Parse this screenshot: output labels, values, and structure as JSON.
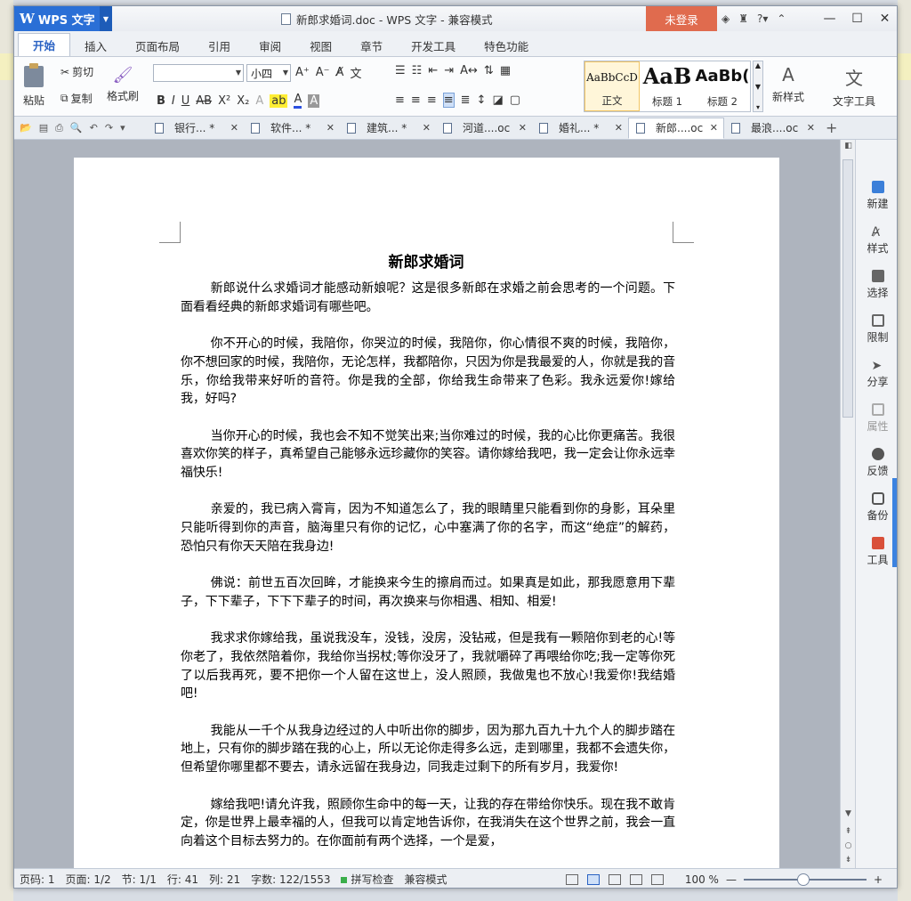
{
  "app": {
    "name": "WPS 文字",
    "login": "未登录"
  },
  "window": {
    "title": "新郎求婚词.doc - WPS 文字 - 兼容模式"
  },
  "menu": [
    "开始",
    "插入",
    "页面布局",
    "引用",
    "审阅",
    "视图",
    "章节",
    "开发工具",
    "特色功能"
  ],
  "ribbon": {
    "paste": "粘贴",
    "cut": "剪切",
    "copy": "复制",
    "format_painter": "格式刷",
    "font_size": "小四",
    "styles": [
      {
        "sample": "AaBbCcD",
        "name": "正文"
      },
      {
        "sample": "AaB",
        "name": "标题 1"
      },
      {
        "sample": "AaBb(",
        "name": "标题 2"
      }
    ],
    "new_style": "新样式",
    "text_tools": "文字工具"
  },
  "tabs": [
    {
      "label": "银行... *",
      "active": false
    },
    {
      "label": "软件... *",
      "active": false
    },
    {
      "label": "建筑... *",
      "active": false
    },
    {
      "label": "河道....oc",
      "active": false
    },
    {
      "label": "婚礼... *",
      "active": false
    },
    {
      "label": "新郎....oc",
      "active": true
    },
    {
      "label": "最浪....oc",
      "active": false
    }
  ],
  "document": {
    "title": "新郎求婚词",
    "paragraphs": [
      "新郎说什么求婚词才能感动新娘呢？这是很多新郎在求婚之前会思考的一个问题。下面看看经典的新郎求婚词有哪些吧。",
      "你不开心的时候，我陪你，你哭泣的时候，我陪你，你心情很不爽的时候，我陪你，你不想回家的时候，我陪你，无论怎样，我都陪你，只因为你是我最爱的人，你就是我的音乐，你给我带来好听的音符。你是我的全部，你给我生命带来了色彩。我永远爱你!嫁给我，好吗?",
      "当你开心的时候，我也会不知不觉笑出来;当你难过的时候，我的心比你更痛苦。我很喜欢你笑的样子，真希望自己能够永远珍藏你的笑容。请你嫁给我吧，我一定会让你永远幸福快乐!",
      "亲爱的，我已病入膏肓，因为不知道怎么了，我的眼睛里只能看到你的身影，耳朵里只能听得到你的声音，脑海里只有你的记忆，心中塞满了你的名字，而这“绝症”的解药，恐怕只有你天天陪在我身边!",
      "佛说：前世五百次回眸，才能换来今生的擦肩而过。如果真是如此，那我愿意用下辈子，下下辈子，下下下辈子的时间，再次换来与你相遇、相知、相爱!",
      "  我求求你嫁给我，虽说我没车，没钱，没房，没钻戒，但是我有一颗陪你到老的心!等你老了，我依然陪着你，我给你当拐杖;等你没牙了，我就嚼碎了再喂给你吃;我一定等你死了以后我再死，要不把你一个人留在这世上，没人照顾，我做鬼也不放心!我爱你!我结婚吧!",
      "我能从一千个从我身边经过的人中听出你的脚步，因为那九百九十九个人的脚步踏在地上，只有你的脚步踏在我的心上，所以无论你走得多么远，走到哪里，我都不会遗失你，但希望你哪里都不要去，请永远留在我身边，同我走过剩下的所有岁月，我爱你!",
      "嫁给我吧!请允许我，照顾你生命中的每一天，让我的存在带给你快乐。现在我不敢肯定，你是世界上最幸福的人，但我可以肯定地告诉你，在我消失在这个世界之前，我会一直向着这个目标去努力的。在你面前有两个选择，一个是爱，"
    ]
  },
  "side_panel": [
    "新建",
    "样式",
    "选择",
    "限制",
    "分享",
    "属性",
    "反馈",
    "备份",
    "工具"
  ],
  "status": {
    "page_code": "页码: 1",
    "page": "页面: 1/2",
    "section": "节: 1/1",
    "line": "行: 41",
    "col": "列: 21",
    "words": "字数: 122/1553",
    "spell": "拼写检查",
    "mode": "兼容模式",
    "zoom": "100 %"
  }
}
